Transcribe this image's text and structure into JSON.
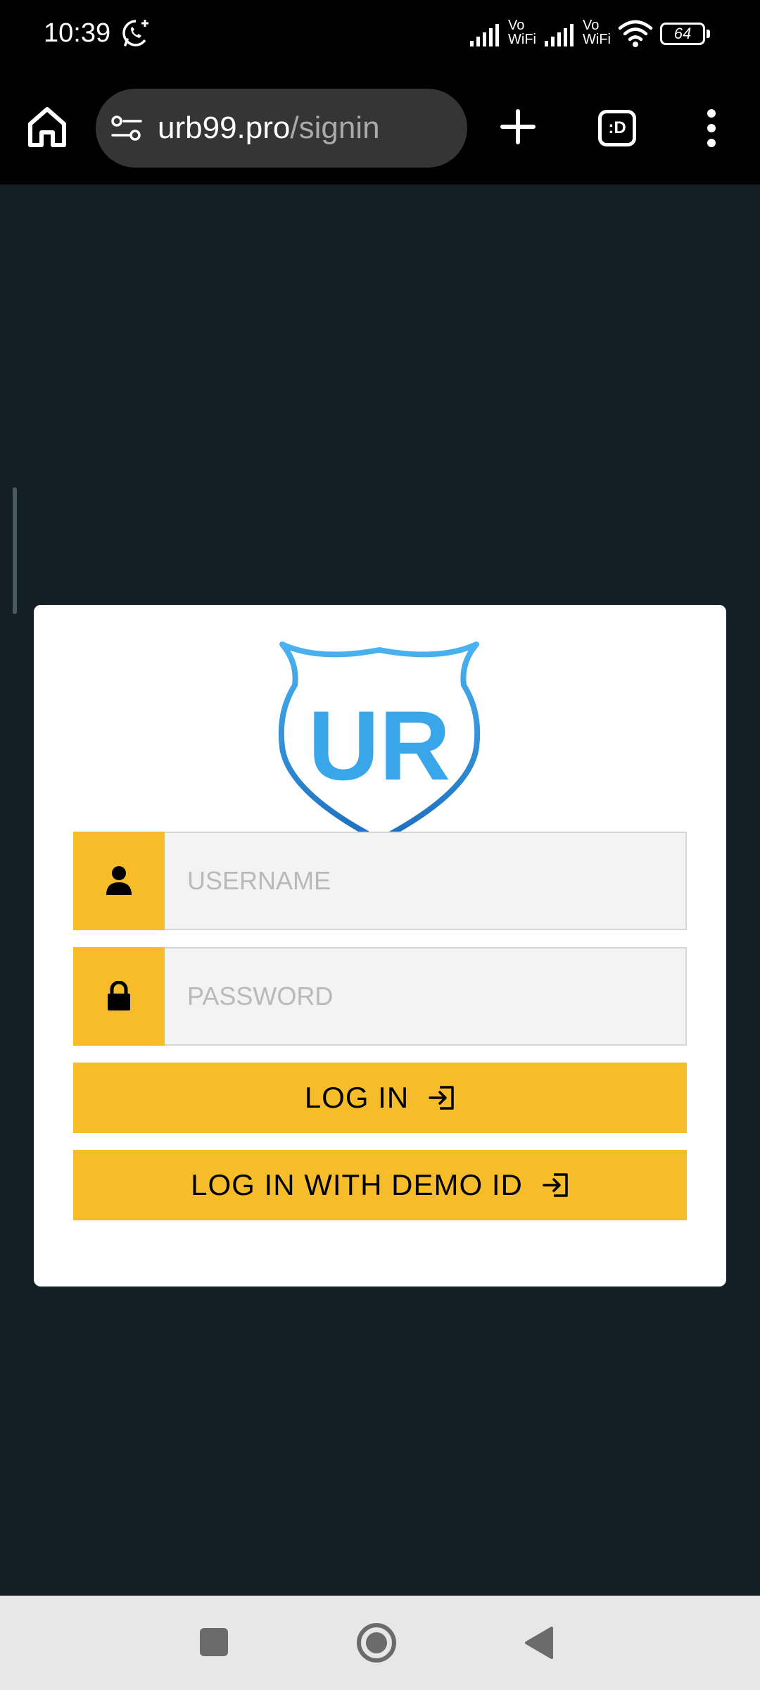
{
  "status_bar": {
    "time": "10:39",
    "sim1_label_top": "Vo",
    "sim1_label_bottom": "WiFi",
    "sim2_label_top": "Vo",
    "sim2_label_bottom": "WiFi",
    "battery_level": "64",
    "icons": [
      "whatsapp-icon",
      "signal-icon",
      "wifi-icon",
      "battery-icon"
    ]
  },
  "browser": {
    "url_domain": "urb99.pro",
    "url_path": "/signin",
    "tabs_label": ":D",
    "icons": [
      "home-icon",
      "site-settings-icon",
      "plus-icon",
      "tabs-icon",
      "more-vert-icon"
    ]
  },
  "login": {
    "username_placeholder": "USERNAME",
    "password_placeholder": "PASSWORD",
    "login_label": "LOG IN",
    "demo_label": "LOG IN WITH DEMO ID",
    "logo_text": "UR"
  },
  "colors": {
    "page_bg": "#121f24",
    "accent": "#f6bc29",
    "logo_blue": "#3aa6ea",
    "input_bg": "#f3f3f3"
  },
  "nav_bar": {
    "icons": [
      "recents-icon",
      "home-circle-icon",
      "back-icon"
    ]
  }
}
